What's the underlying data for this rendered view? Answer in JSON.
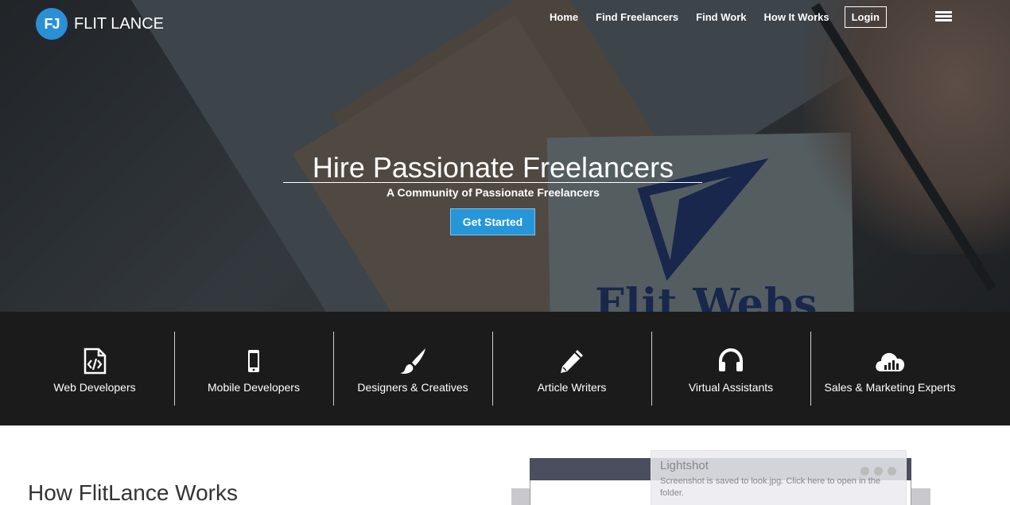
{
  "brand": {
    "logo_mark": "FJ",
    "name": "FLIT LANCE"
  },
  "nav": {
    "items": [
      {
        "label": "Home"
      },
      {
        "label": "Find Freelancers"
      },
      {
        "label": "Find Work"
      },
      {
        "label": "How It Works"
      }
    ],
    "login": "Login",
    "menu_icon": "hamburger-list-icon"
  },
  "hero": {
    "title": "Hire Passionate Freelancers",
    "subtitle": "A Community of Passionate Freelancers",
    "cta": "Get Started",
    "background_card_text": "Flit Webs"
  },
  "categories": [
    {
      "label": "Web Developers",
      "icon": "code-file-icon"
    },
    {
      "label": "Mobile Developers",
      "icon": "mobile-phone-icon"
    },
    {
      "label": "Designers & Creatives",
      "icon": "paintbrush-icon"
    },
    {
      "label": "Article Writers",
      "icon": "pencil-icon"
    },
    {
      "label": "Virtual Assistants",
      "icon": "headphones-icon"
    },
    {
      "label": "Sales & Marketing Experts",
      "icon": "cloud-chart-icon"
    }
  ],
  "section": {
    "how_title": "How FlitLance Works"
  },
  "lightshot": {
    "title": "Lightshot",
    "message": "Screenshot is saved to look.jpg. Click here to open in the folder."
  },
  "colors": {
    "accent": "#2596d8",
    "dark_band": "#1b1b1b",
    "logo": "#2b8fd6"
  }
}
